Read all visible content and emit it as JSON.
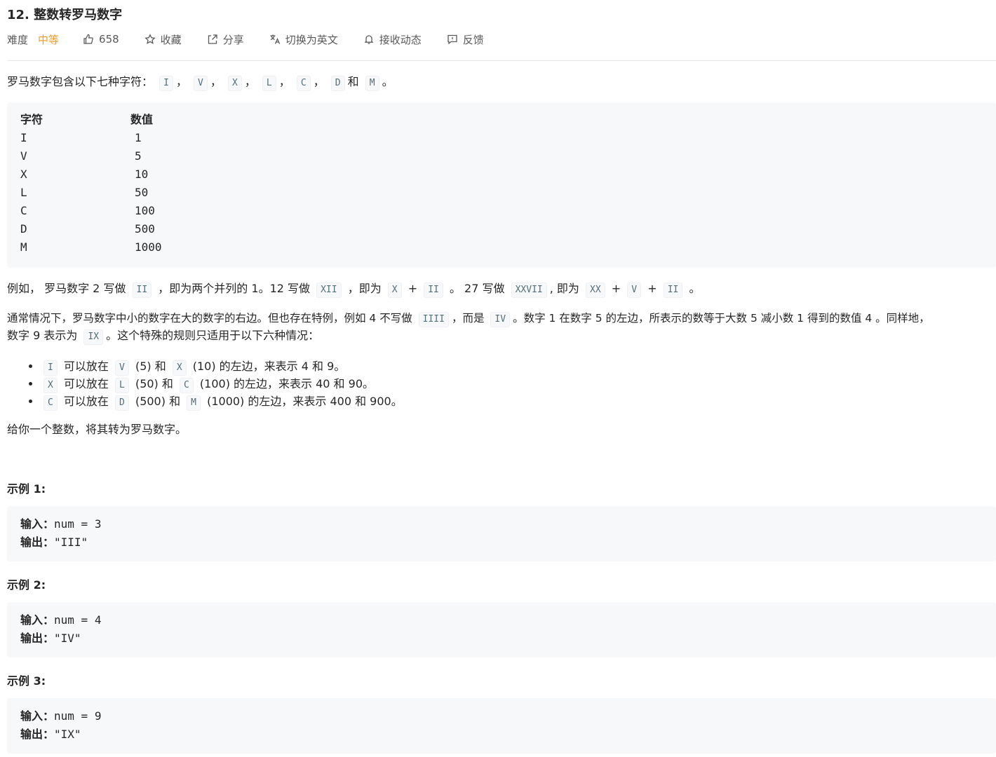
{
  "problem": {
    "title": "12. 整数转罗马数字",
    "difficulty_label": "难度",
    "difficulty_value": "中等",
    "likes": "658",
    "actions": {
      "favorite": "收藏",
      "share": "分享",
      "switch_lang": "切换为英文",
      "subscribe": "接收动态",
      "feedback": "反馈"
    }
  },
  "description": {
    "intro_text": "罗马数字包含以下七种字符：",
    "intro_codes": [
      "I",
      "V",
      "X",
      "L",
      "C",
      "D",
      "M"
    ],
    "intro_sep": "，",
    "intro_and": "和",
    "intro_end": "。",
    "table": {
      "headers": [
        "字符",
        "数值"
      ],
      "rows": [
        [
          "I",
          "1"
        ],
        [
          "V",
          "5"
        ],
        [
          "X",
          "10"
        ],
        [
          "L",
          "50"
        ],
        [
          "C",
          "100"
        ],
        [
          "D",
          "500"
        ],
        [
          "M",
          "1000"
        ]
      ]
    },
    "example_para": {
      "t1": "例如， 罗马数字 2 写做",
      "c1": "II",
      "t2": "，即为两个并列的 1。12 写做",
      "c2": "XII",
      "t3": "，即为",
      "c3": "X",
      "t4": "+",
      "c4": "II",
      "t5": "。 27 写做",
      "c5": "XXVII",
      "t6": ", 即为",
      "c6": "XX",
      "t7": "+",
      "c7": "V",
      "t8": "+",
      "c8": "II",
      "t9": "。"
    },
    "special_para": {
      "l1_t1": "通常情况下，罗马数字中小的数字在大的数字的右边。但也存在特例，例如 4 不写做",
      "l1_c1": "IIII",
      "l1_t2": "，而是",
      "l1_c2": "IV",
      "l1_t3": "。数字 1 在数字 5 的左边，所表示的数等于大数 5 减小数 1 得到的数值 4 。同样地，",
      "l2_t1": "数字 9 表示为",
      "l2_c1": "IX",
      "l2_t2": "。这个特殊的规则只适用于以下六种情况："
    },
    "rules": [
      {
        "c1": "I",
        "t1": "可以放在",
        "c2": "V",
        "t2": "(5) 和",
        "c3": "X",
        "t3": "(10) 的左边，来表示 4 和 9。"
      },
      {
        "c1": "X",
        "t1": "可以放在",
        "c2": "L",
        "t2": "(50) 和",
        "c3": "C",
        "t3": "(100) 的左边，来表示 40 和 90。"
      },
      {
        "c1": "C",
        "t1": "可以放在",
        "c2": "D",
        "t2": "(500) 和",
        "c3": "M",
        "t3": "(1000) 的左边，来表示 400 和 900。"
      }
    ],
    "task": "给你一个整数，将其转为罗马数字。"
  },
  "examples": [
    {
      "title": "示例 1:",
      "in_label": "输入：",
      "input": "num = 3",
      "out_label": "输出：",
      "output": "\"III\""
    },
    {
      "title": "示例 2:",
      "in_label": "输入：",
      "input": "num = 4",
      "out_label": "输出：",
      "output": "\"IV\""
    },
    {
      "title": "示例 3:",
      "in_label": "输入：",
      "input": "num = 9",
      "out_label": "输出：",
      "output": "\"IX\""
    }
  ]
}
